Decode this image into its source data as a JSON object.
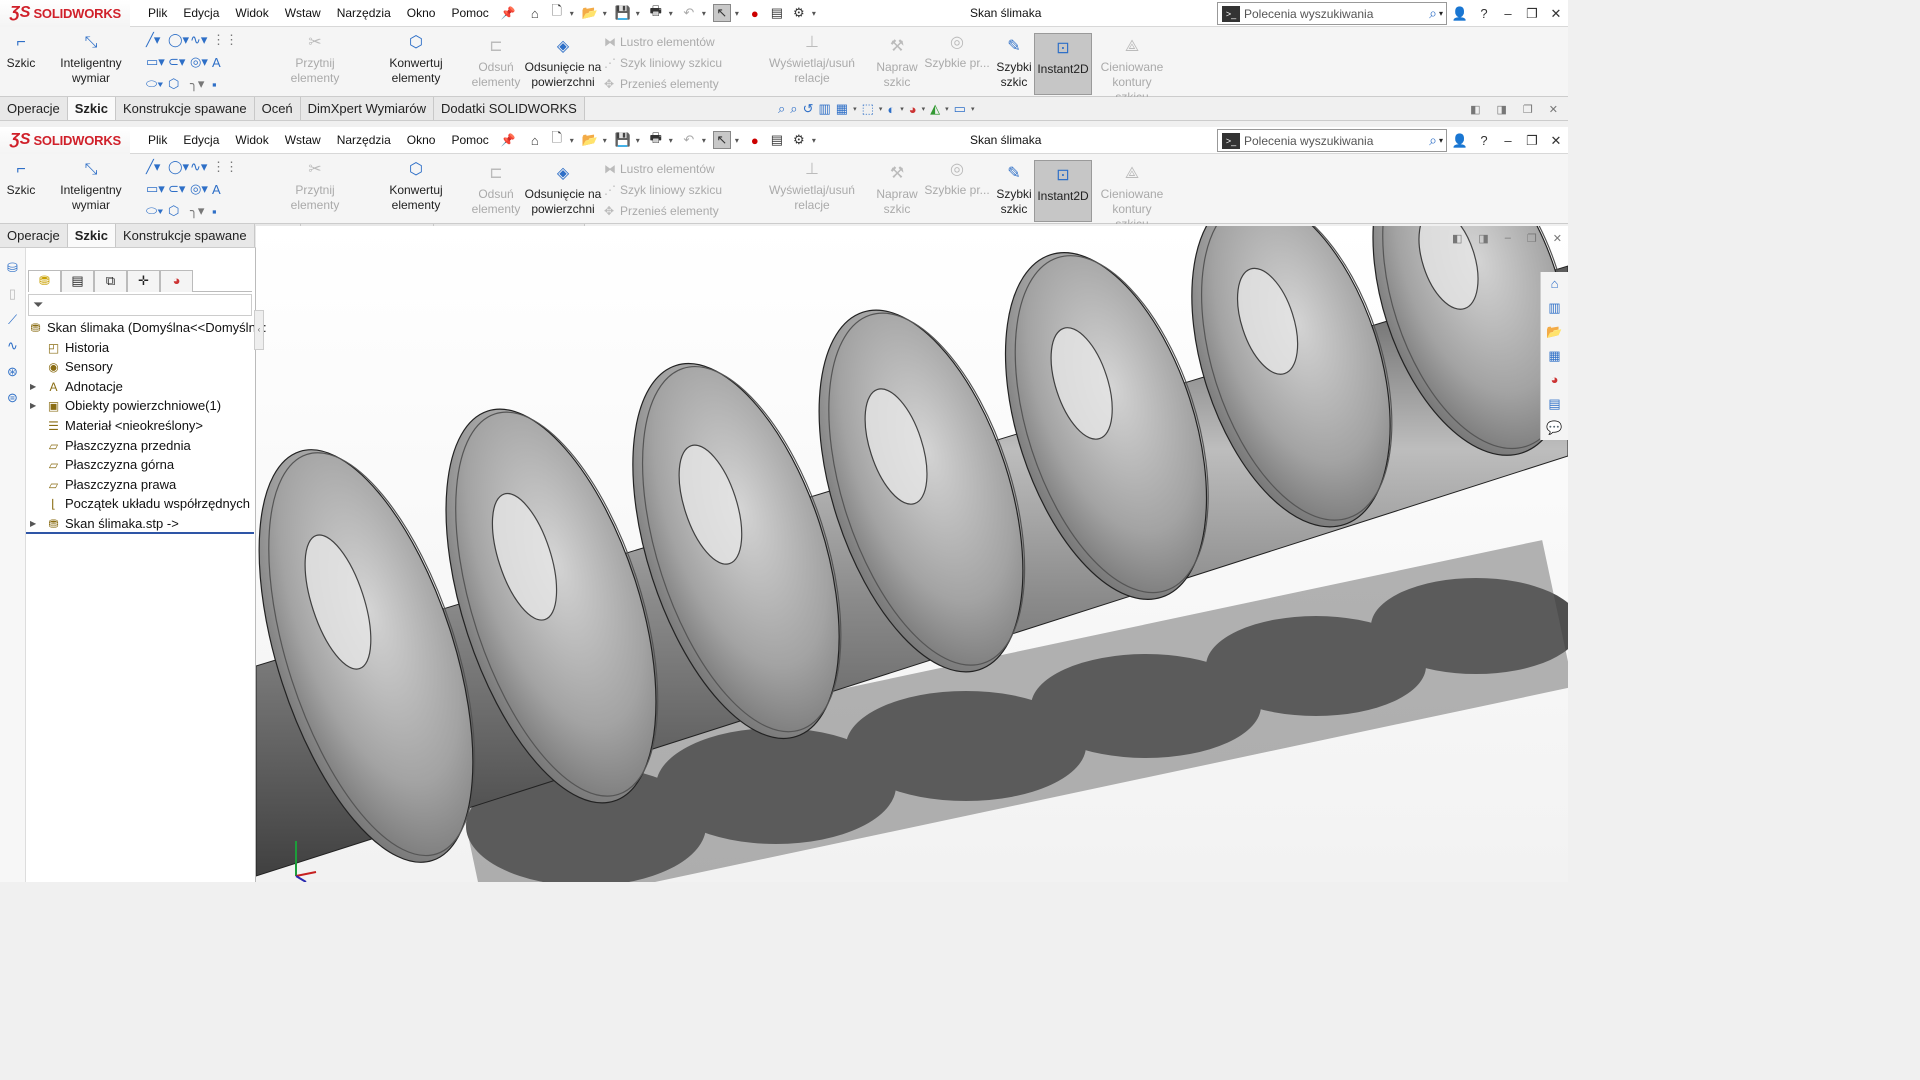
{
  "app": {
    "logo_ds": "ƷS",
    "logo_text": "SOLIDWORKS",
    "document_title": "Skan ślimaka"
  },
  "menu": [
    "Plik",
    "Edycja",
    "Widok",
    "Wstaw",
    "Narzędzia",
    "Okno",
    "Pomoc"
  ],
  "search": {
    "placeholder": "Polecenia wyszukiwania"
  },
  "ribbon": {
    "szkic": "Szkic",
    "inteligentny_wymiar": "Inteligentny wymiar",
    "przytnij_elementy": "Przytnij elementy",
    "konwertuj_elementy": "Konwertuj elementy",
    "odsun_elementy_1": "Odsuń",
    "odsun_elementy_2": "elementy",
    "odsuniecie_1": "Odsunięcie na",
    "odsuniecie_2": "powierzchni",
    "lustro": "Lustro elementów",
    "szyk_liniowy": "Szyk liniowy szkicu",
    "przenies": "Przenieś elementy",
    "wyswietlaj": "Wyświetlaj/usuń relacje",
    "napraw_1": "Napraw",
    "napraw_2": "szkic",
    "szybkie_pr": "Szybkie pr...",
    "szybki_1": "Szybki",
    "szybki_2": "szkic",
    "instant2d": "Instant2D",
    "cieniowane_1": "Cieniowane",
    "cieniowane_2": "kontury szkicu"
  },
  "tabs": [
    "Operacje",
    "Szkic",
    "Konstrukcje spawane",
    "Oceń",
    "DimXpert Wymiarów",
    "Dodatki SOLIDWORKS"
  ],
  "active_tab": "Szkic",
  "feature_tree": {
    "root": "Skan ślimaka  (Domyślna<<Domyślna:",
    "items": [
      {
        "label": "Historia",
        "icon": "history-icon",
        "expandable": false
      },
      {
        "label": "Sensory",
        "icon": "sensors-icon",
        "expandable": false
      },
      {
        "label": "Adnotacje",
        "icon": "annotations-icon",
        "expandable": true
      },
      {
        "label": "Obiekty powierzchniowe(1)",
        "icon": "surface-bodies-icon",
        "expandable": true
      },
      {
        "label": "Materiał <nieokreślony>",
        "icon": "material-icon",
        "expandable": false
      },
      {
        "label": "Płaszczyzna przednia",
        "icon": "plane-icon",
        "expandable": false
      },
      {
        "label": "Płaszczyzna górna",
        "icon": "plane-icon",
        "expandable": false
      },
      {
        "label": "Płaszczyzna prawa",
        "icon": "plane-icon",
        "expandable": false
      },
      {
        "label": "Początek układu współrzędnych",
        "icon": "origin-icon",
        "expandable": false
      },
      {
        "label": "Skan ślimaka.stp ->",
        "icon": "imported-part-icon",
        "expandable": true
      }
    ]
  },
  "colors": {
    "brand_red": "#d0202a",
    "accent_blue": "#2e6fc7",
    "active_button": "#c6c6c6"
  }
}
